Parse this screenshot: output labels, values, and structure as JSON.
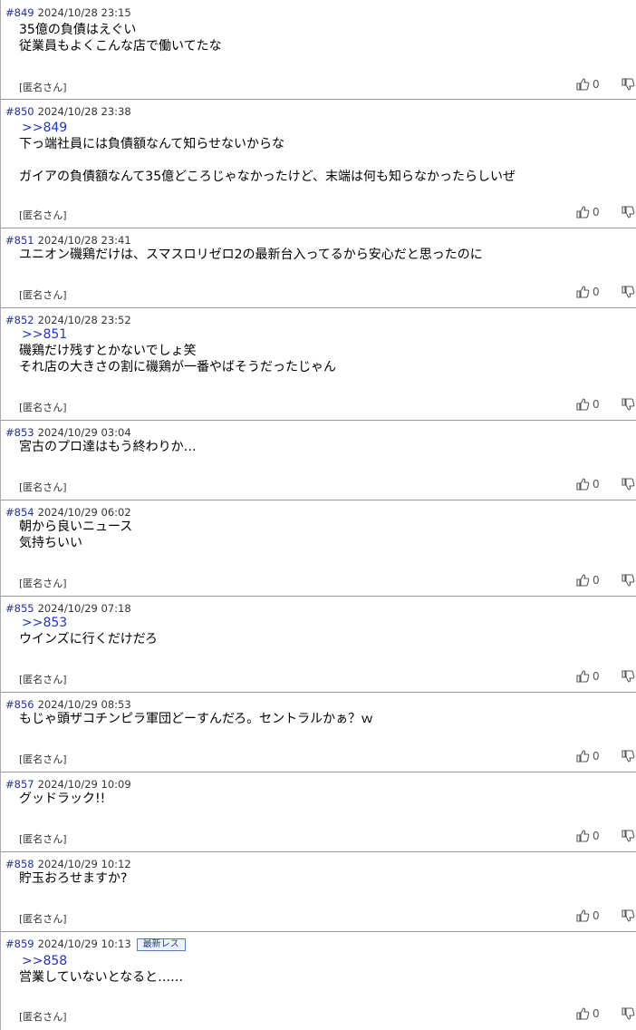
{
  "thumbs_up_icon": "thumbs-up-icon",
  "thumbs_down_icon": "thumbs-down-icon",
  "posts": [
    {
      "number": "#849",
      "date": "2024/10/28 23:15",
      "anchor": "",
      "lines": [
        "35億の負債はえぐい",
        "従業員もよくこんな店で働いてたな"
      ],
      "author": "[匿名さん]",
      "likes": "0"
    },
    {
      "number": "#850",
      "date": "2024/10/28 23:38",
      "anchor": ">>849",
      "lines": [
        "下っ端社員には負債額なんて知らせないからな",
        "",
        "ガイアの負債額なんて35億どころじゃなかったけど、末端は何も知らなかったらしいぜ"
      ],
      "author": "[匿名さん]",
      "likes": "0"
    },
    {
      "number": "#851",
      "date": "2024/10/28 23:41",
      "anchor": "",
      "lines": [
        "ユニオン磯鶏だけは、スマスロリゼロ2の最新台入ってるから安心だと思ったのに"
      ],
      "author": "[匿名さん]",
      "likes": "0"
    },
    {
      "number": "#852",
      "date": "2024/10/28 23:52",
      "anchor": ">>851",
      "lines": [
        "磯鶏だけ残すとかないでしょ笑",
        "それ店の大きさの割に磯鶏が一番やばそうだったじゃん"
      ],
      "author": "[匿名さん]",
      "likes": "0"
    },
    {
      "number": "#853",
      "date": "2024/10/29 03:04",
      "anchor": "",
      "lines": [
        "宮古のプロ達はもう終わりか…"
      ],
      "author": "[匿名さん]",
      "likes": "0"
    },
    {
      "number": "#854",
      "date": "2024/10/29 06:02",
      "anchor": "",
      "lines": [
        "朝から良いニュース",
        "気持ちいい"
      ],
      "author": "[匿名さん]",
      "likes": "0"
    },
    {
      "number": "#855",
      "date": "2024/10/29 07:18",
      "anchor": ">>853",
      "lines": [
        "ウインズに行くだけだろ"
      ],
      "author": "[匿名さん]",
      "likes": "0"
    },
    {
      "number": "#856",
      "date": "2024/10/29 08:53",
      "anchor": "",
      "lines": [
        "もじゃ頭ザコチンピラ軍団どーすんだろ。セントラルかぁ？ｗ"
      ],
      "author": "[匿名さん]",
      "likes": "0"
    },
    {
      "number": "#857",
      "date": "2024/10/29 10:09",
      "anchor": "",
      "lines": [
        "グッドラック!!"
      ],
      "author": "[匿名さん]",
      "likes": "0"
    },
    {
      "number": "#858",
      "date": "2024/10/29 10:12",
      "anchor": "",
      "lines": [
        "貯玉おろせますか?"
      ],
      "author": "[匿名さん]",
      "likes": "0"
    },
    {
      "number": "#859",
      "date": "2024/10/29 10:13",
      "badge": "最新レス",
      "anchor": ">>858",
      "lines": [
        "営業していないとなると……"
      ],
      "author": "[匿名さん]",
      "likes": "0"
    }
  ]
}
